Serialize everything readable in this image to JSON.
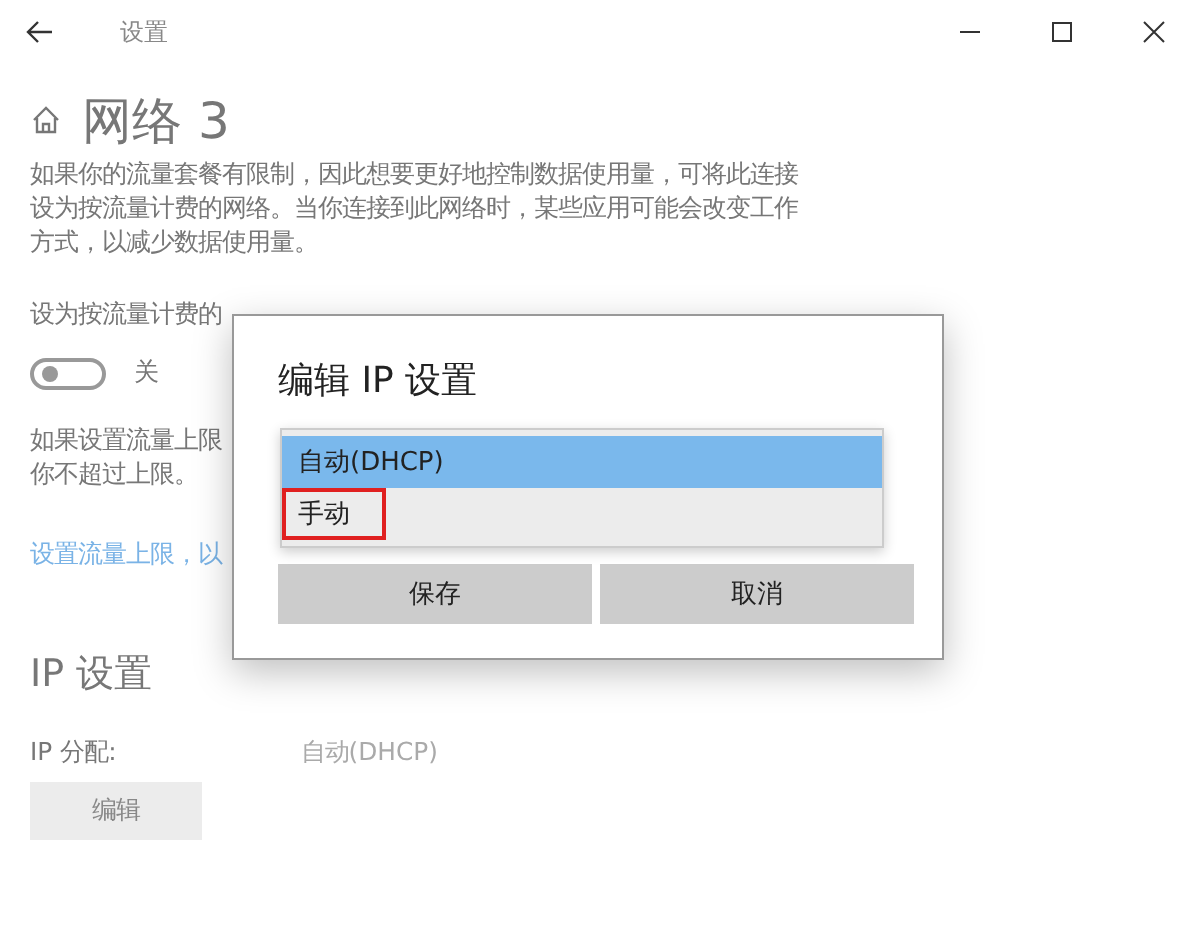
{
  "window": {
    "title": "设置"
  },
  "page": {
    "title": "网络 3",
    "description": [
      "如果你的流量套餐有限制，因此想要更好地控制数据使用量，可将此连接",
      "设为按流量计费的网络。当你连接到此网络时，某些应用可能会改变工作",
      "方式，以减少数据使用量。"
    ],
    "metered_label": "设为按流量计费的",
    "metered_toggle": {
      "on": false,
      "state_label": "关"
    },
    "limit_note": [
      "如果设置流量上限",
      "你不超过上限。"
    ],
    "limit_link": "设置流量上限，以"
  },
  "ip_settings": {
    "heading": "IP 设置",
    "assignment_label": "IP 分配:",
    "assignment_value": "自动(DHCP)",
    "edit_button": "编辑"
  },
  "dialog": {
    "title": "编辑 IP 设置",
    "options": [
      {
        "label": "自动(DHCP)",
        "selected": true,
        "focused": false
      },
      {
        "label": "手动",
        "selected": false,
        "focused": true
      }
    ],
    "buttons": [
      "保存",
      "取消"
    ]
  }
}
